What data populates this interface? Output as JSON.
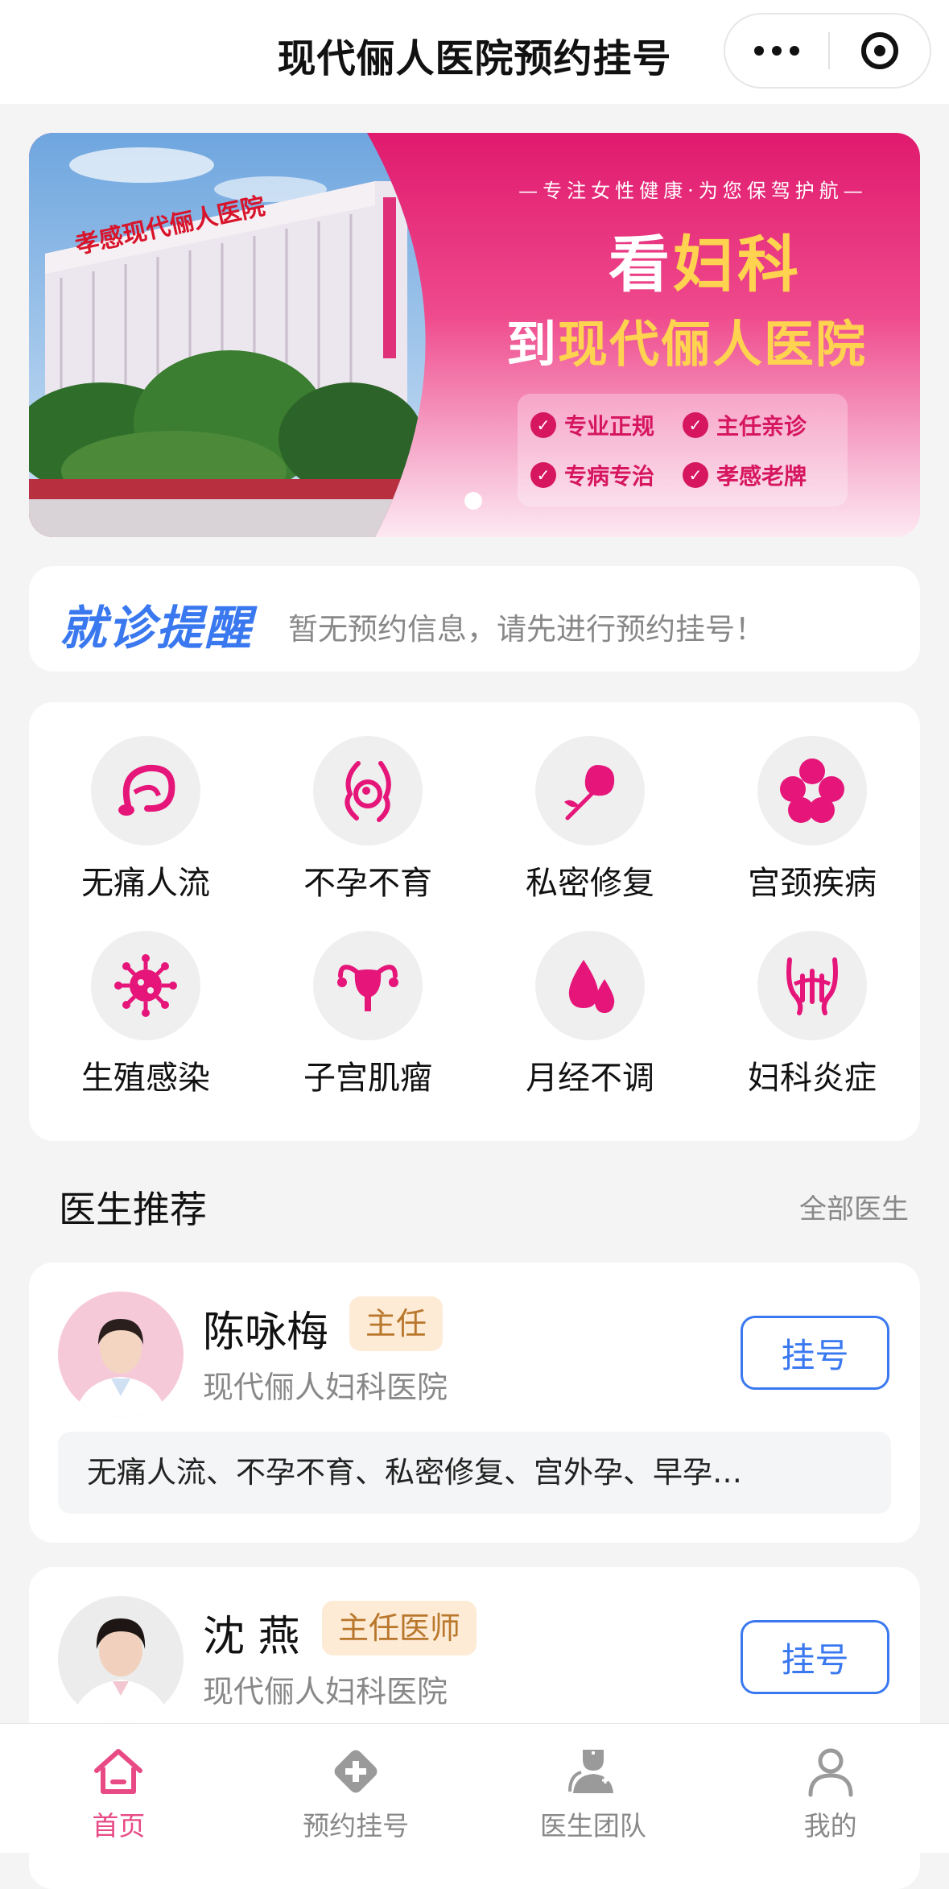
{
  "nav": {
    "title": "现代俪人医院预约挂号"
  },
  "banner": {
    "slogan": "—专注女性健康·为您保驾护航—",
    "headline_prefix": "看",
    "headline_highlight": "妇科",
    "subline_prefix": "到",
    "subline_highlight": "现代俪人医院",
    "building_sign": "孝感现代俪人医院",
    "tags": [
      "专业正规",
      "主任亲诊",
      "专病专治",
      "孝感老牌"
    ],
    "colors": {
      "primary": "#e01a6e",
      "highlight": "#ffd34f"
    }
  },
  "reminder": {
    "title": "就诊提醒",
    "text": "暂无预约信息，请先进行预约挂号！"
  },
  "categories": [
    {
      "label": "无痛人流",
      "icon": "abortion-icon"
    },
    {
      "label": "不孕不育",
      "icon": "pregnancy-icon"
    },
    {
      "label": "私密修复",
      "icon": "rose-icon"
    },
    {
      "label": "宫颈疾病",
      "icon": "flower-icon"
    },
    {
      "label": "生殖感染",
      "icon": "virus-icon"
    },
    {
      "label": "子宫肌瘤",
      "icon": "uterus-icon"
    },
    {
      "label": "月经不调",
      "icon": "drops-icon"
    },
    {
      "label": "妇科炎症",
      "icon": "pelvis-icon"
    }
  ],
  "doctors_section": {
    "title": "医生推荐",
    "more": "全部医生"
  },
  "doctors": [
    {
      "name": "陈咏梅",
      "title": "主任",
      "hospital": "现代俪人妇科医院",
      "specialties": "无痛人流、不孕不育、私密修复、宫外孕、早孕…",
      "button": "挂号"
    },
    {
      "name": "沈 燕",
      "title": "主任医师",
      "hospital": "现代俪人妇科医院",
      "button": "挂号"
    }
  ],
  "tabbar": [
    {
      "label": "首页",
      "icon": "home-icon",
      "active": true
    },
    {
      "label": "预约挂号",
      "icon": "medical-cross-icon",
      "active": false
    },
    {
      "label": "医生团队",
      "icon": "doctor-team-icon",
      "active": false
    },
    {
      "label": "我的",
      "icon": "user-icon",
      "active": false
    }
  ],
  "colors": {
    "accent_pink": "#e5157a",
    "accent_blue": "#3a78f0",
    "badge_bg": "#fdebd6",
    "badge_text": "#b9772c"
  }
}
